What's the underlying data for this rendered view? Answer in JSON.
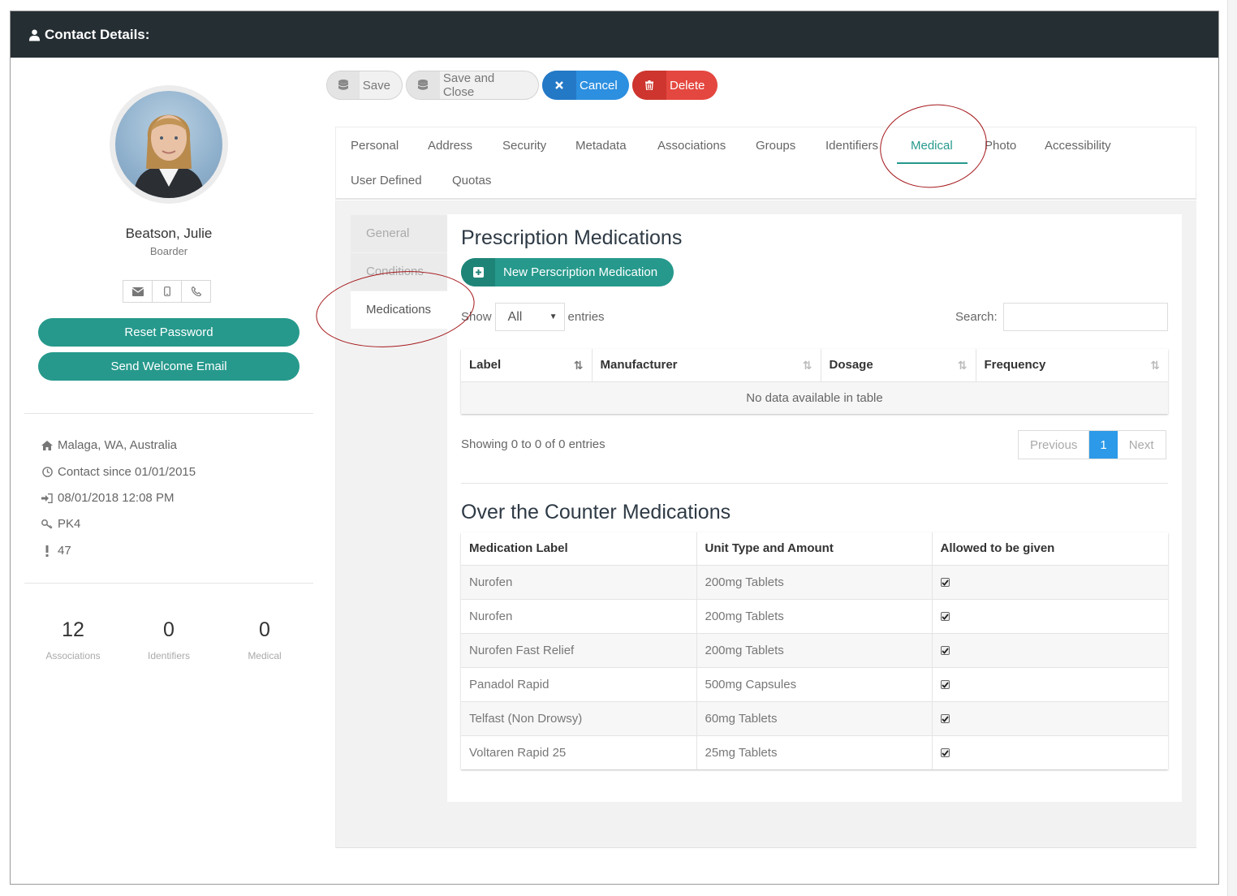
{
  "header": {
    "title": "Contact Details:"
  },
  "profile": {
    "name": "Beatson, Julie",
    "role": "Boarder",
    "reset_password_label": "Reset Password",
    "send_welcome_label": "Send Welcome Email"
  },
  "info": {
    "location": "Malaga, WA, Australia",
    "contact_since": "Contact since 01/01/2015",
    "last_login": "08/01/2018 12:08 PM",
    "key": "PK4",
    "alert": "47"
  },
  "stats": [
    {
      "value": "12",
      "label": "Associations"
    },
    {
      "value": "0",
      "label": "Identifiers"
    },
    {
      "value": "0",
      "label": "Medical"
    }
  ],
  "toolbar": {
    "save": "Save",
    "save_close": "Save and Close",
    "cancel": "Cancel",
    "delete": "Delete"
  },
  "tabs": [
    "Personal",
    "Address",
    "Security",
    "Metadata",
    "Associations",
    "Groups",
    "Identifiers",
    "Medical",
    "Photo",
    "Accessibility",
    "User Defined",
    "Quotas"
  ],
  "active_tab": "Medical",
  "sidenav": [
    "General",
    "Conditions",
    "Medications"
  ],
  "active_sidenav": "Medications",
  "prescription": {
    "title": "Prescription Medications",
    "new_button": "New Perscription Medication",
    "show_label": "Show",
    "show_value": "All",
    "entries_label": "entries",
    "search_label": "Search:",
    "search_value": "",
    "columns": [
      "Label",
      "Manufacturer",
      "Dosage",
      "Frequency"
    ],
    "empty_message": "No data available in table",
    "showing": "Showing 0 to 0 of 0 entries",
    "pager": {
      "previous": "Previous",
      "current": "1",
      "next": "Next"
    }
  },
  "otc": {
    "title": "Over the Counter Medications",
    "columns": [
      "Medication Label",
      "Unit Type and Amount",
      "Allowed to be given"
    ],
    "rows": [
      {
        "label": "Nurofen",
        "unit": "200mg Tablets",
        "allowed": true
      },
      {
        "label": "Nurofen",
        "unit": "200mg Tablets",
        "allowed": true
      },
      {
        "label": "Nurofen Fast Relief",
        "unit": "200mg Tablets",
        "allowed": true
      },
      {
        "label": "Panadol Rapid",
        "unit": "500mg Capsules",
        "allowed": true
      },
      {
        "label": "Telfast (Non Drowsy)",
        "unit": "60mg Tablets",
        "allowed": true
      },
      {
        "label": "Voltaren Rapid 25",
        "unit": "25mg Tablets",
        "allowed": true
      }
    ]
  },
  "colors": {
    "teal": "#26998c",
    "blue": "#2c8fe0",
    "red": "#e4473f",
    "header_bg": "#252e33",
    "annotation": "#a4161a"
  }
}
